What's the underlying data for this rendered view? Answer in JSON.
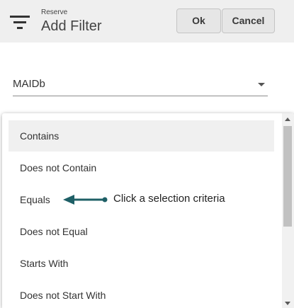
{
  "header": {
    "eyebrow": "Reserve",
    "title": "Add Filter",
    "ok_label": "Ok",
    "cancel_label": "Cancel",
    "icon": "filter-icon"
  },
  "field": {
    "value": "MAIDb",
    "icon": "chevron-down-icon"
  },
  "dropdown": {
    "options": [
      {
        "label": "Contains",
        "highlighted": true
      },
      {
        "label": "Does not Contain",
        "highlighted": false
      },
      {
        "label": "Equals",
        "highlighted": false
      },
      {
        "label": "Does not Equal",
        "highlighted": false
      },
      {
        "label": "Starts With",
        "highlighted": false
      },
      {
        "label": "Does not Start With",
        "highlighted": false
      }
    ]
  },
  "annotation": {
    "text": "Click a selection criteria",
    "color": "#1e5f66",
    "icon": "arrow-left-icon"
  },
  "colors": {
    "header_bg": "#efefef",
    "highlight_bg": "#f0f0f0",
    "backdrop": "#7f7f7f"
  }
}
